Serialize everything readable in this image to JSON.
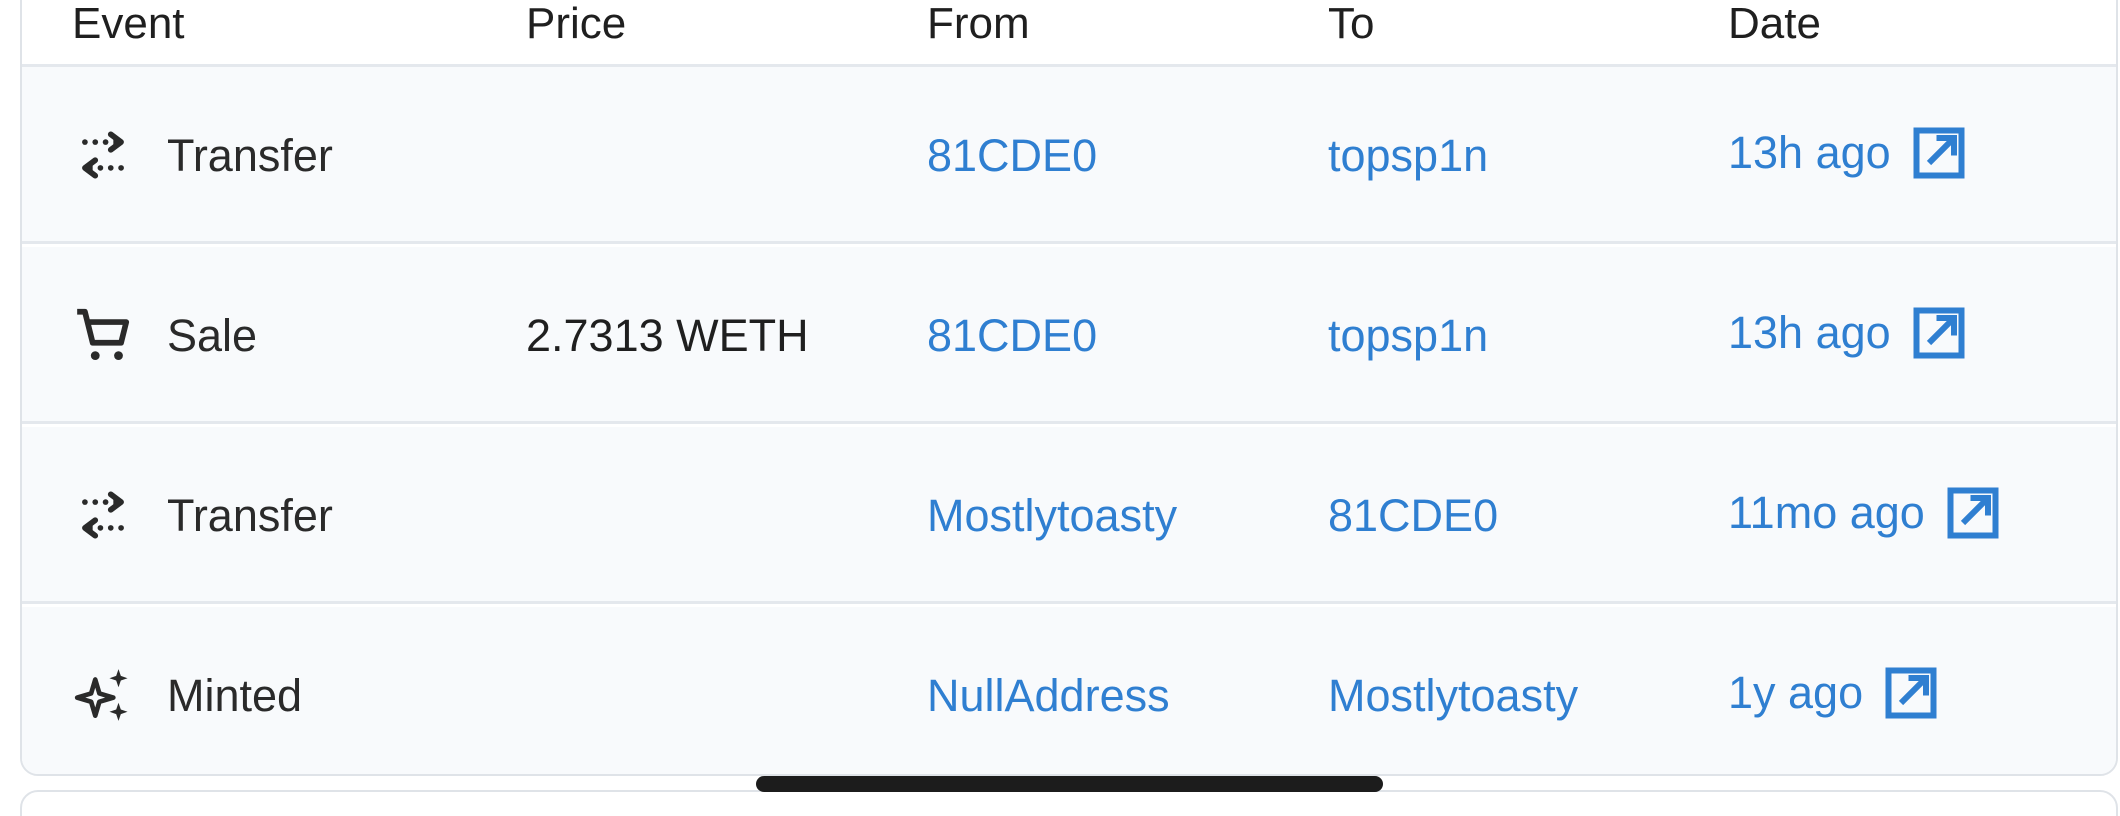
{
  "table": {
    "headers": {
      "event": "Event",
      "price": "Price",
      "from": "From",
      "to": "To",
      "date": "Date"
    },
    "rows": [
      {
        "icon": "transfer-icon",
        "event": "Transfer",
        "price": "",
        "from": "81CDE0",
        "to": "topsp1n",
        "date": "13h ago"
      },
      {
        "icon": "cart-icon",
        "event": "Sale",
        "price": "2.7313 WETH",
        "from": "81CDE0",
        "to": "topsp1n",
        "date": "13h ago"
      },
      {
        "icon": "transfer-icon",
        "event": "Transfer",
        "price": "",
        "from": "Mostlytoasty",
        "to": "81CDE0",
        "date": "11mo ago"
      },
      {
        "icon": "sparkle-icon",
        "event": "Minted",
        "price": "",
        "from": "NullAddress",
        "to": "Mostlytoasty",
        "date": "1y ago"
      }
    ]
  },
  "colors": {
    "link": "#2f7fd1",
    "row_bg": "#f8fafc",
    "divider": "#e4e8ed",
    "text": "#1f1f1f"
  }
}
